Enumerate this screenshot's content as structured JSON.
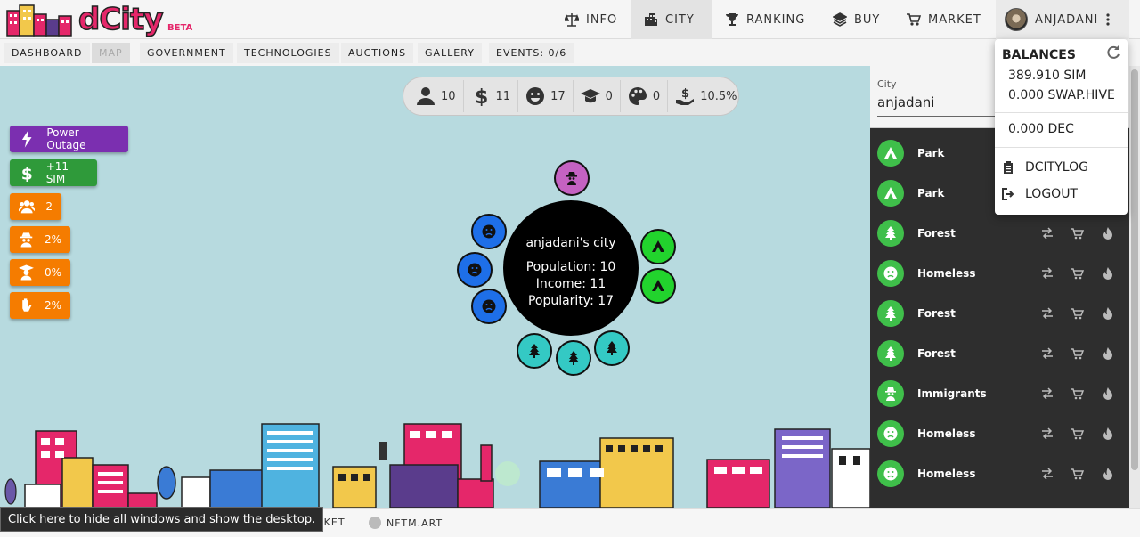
{
  "colors": {
    "brand": "#e5276a",
    "panel_bg": "#2e2e2e",
    "row_icon": "#3fbf4a",
    "power_outage": "#7b2fb0",
    "sim_effect": "#2f9a3a",
    "stat_effect": "#f57c00",
    "bubble_blue": "#1e6fe8",
    "bubble_green": "#22d32d",
    "bubble_teal": "#34c9c4",
    "bubble_purple": "#c462c2"
  },
  "header": {
    "logo_text": "dCity",
    "logo_badge": "BETA",
    "nav": [
      {
        "label": "INFO",
        "icon": "scale-icon"
      },
      {
        "label": "CITY",
        "icon": "city-icon"
      },
      {
        "label": "RANKING",
        "icon": "trophy-icon"
      },
      {
        "label": "BUY",
        "icon": "layers-icon"
      },
      {
        "label": "MARKET",
        "icon": "cart-icon"
      }
    ],
    "user": {
      "name": "ANJADANI",
      "icon": "more-vert-icon"
    }
  },
  "subnav": [
    "DASHBOARD",
    "MAP",
    "GOVERNMENT",
    "TECHNOLOGIES",
    "AUCTIONS",
    "GALLERY",
    "EVENTS: 0/6"
  ],
  "stats": {
    "population": "10",
    "income": "11",
    "popularity": "17",
    "education": "0",
    "culture": "0",
    "tax": "10.5%"
  },
  "effects": {
    "power_outage": "Power Outage",
    "sim": "+11 SIM",
    "people": "2",
    "crime": "2%",
    "education": "0%",
    "stop": "2%"
  },
  "city": {
    "name": "anjadani's city",
    "population": "Population: 10",
    "income": "Income: 11",
    "popularity": "Popularity: 17"
  },
  "panel": {
    "city_label": "City",
    "city_value": "anjadani",
    "rows": [
      {
        "label": "Park",
        "icon": "tent-icon"
      },
      {
        "label": "Park",
        "icon": "tent-icon"
      },
      {
        "label": "Forest",
        "icon": "tree-icon"
      },
      {
        "label": "Homeless",
        "icon": "sad-face-icon"
      },
      {
        "label": "Forest",
        "icon": "tree-icon"
      },
      {
        "label": "Forest",
        "icon": "tree-icon"
      },
      {
        "label": "Immigrants",
        "icon": "spy-icon"
      },
      {
        "label": "Homeless",
        "icon": "sad-face-icon"
      },
      {
        "label": "Homeless",
        "icon": "sad-face-icon"
      }
    ]
  },
  "balances": {
    "title": "BALANCES",
    "sim": "389.910 SIM",
    "swap_hive": "0.000 SWAP.HIVE",
    "dec": "0.000 DEC",
    "link_log": "DCITYLOG",
    "link_logout": "LOGOUT"
  },
  "footer": {
    "market": "MARKET",
    "nftm": "NFTM.ART",
    "tooltip": "Click here to hide all windows and show the desktop."
  }
}
